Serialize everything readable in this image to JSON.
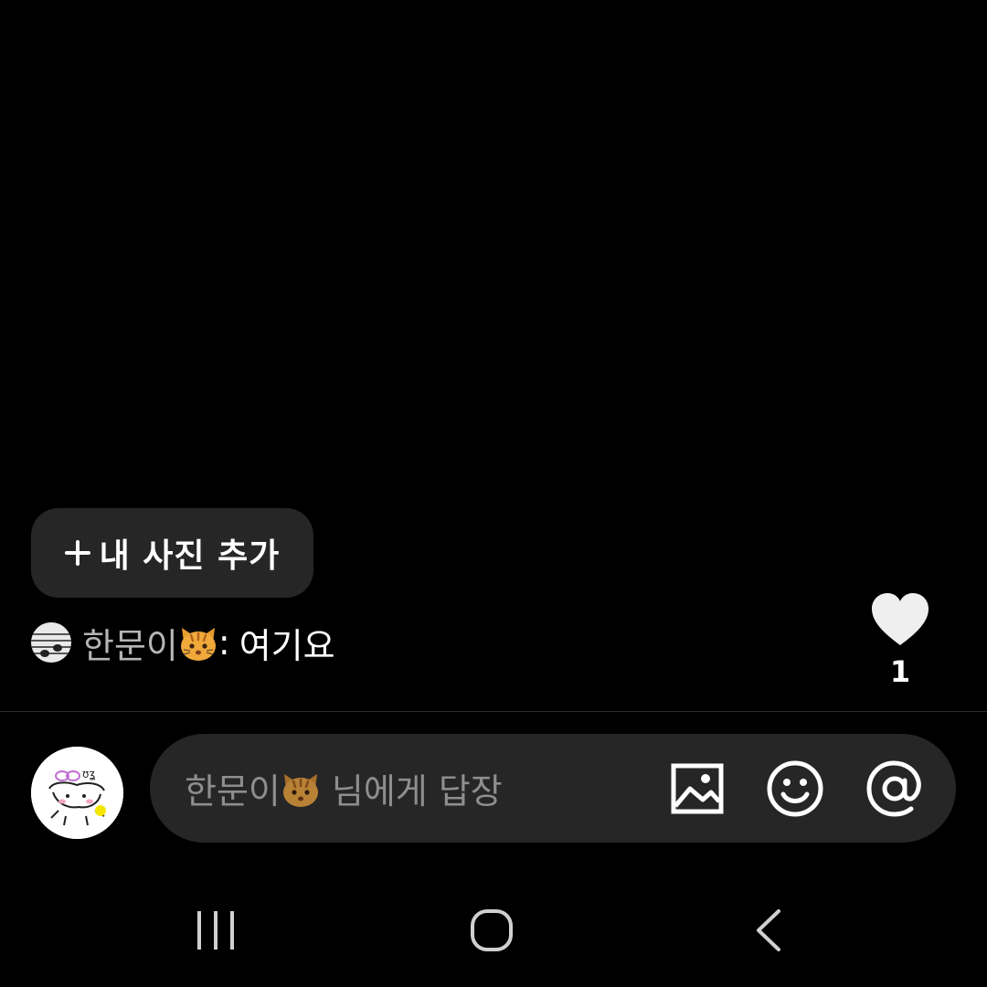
{
  "add_photo": {
    "label": "내 사진 추가",
    "icon": "plus-icon"
  },
  "comment": {
    "avatar_icon": "music-note-avatar",
    "author": "한문이",
    "author_emoji": "cat-emoji",
    "separator": ":",
    "text": "여기요"
  },
  "like": {
    "icon": "heart-icon",
    "count": "1"
  },
  "reply": {
    "avatar_icon": "user-avatar-drawing",
    "placeholder_name": "한문이",
    "placeholder_emoji": "cat-emoji",
    "placeholder_suffix": "님에게 답장",
    "icons": [
      "image-icon",
      "smiley-icon",
      "mention-icon"
    ]
  },
  "nav": {
    "icons": [
      "recent-apps-icon",
      "home-icon",
      "back-icon"
    ]
  },
  "colors": {
    "background": "#000000",
    "surface": "#262626",
    "muted_text": "#8e8e8e",
    "author_text": "#b5b5b5"
  }
}
